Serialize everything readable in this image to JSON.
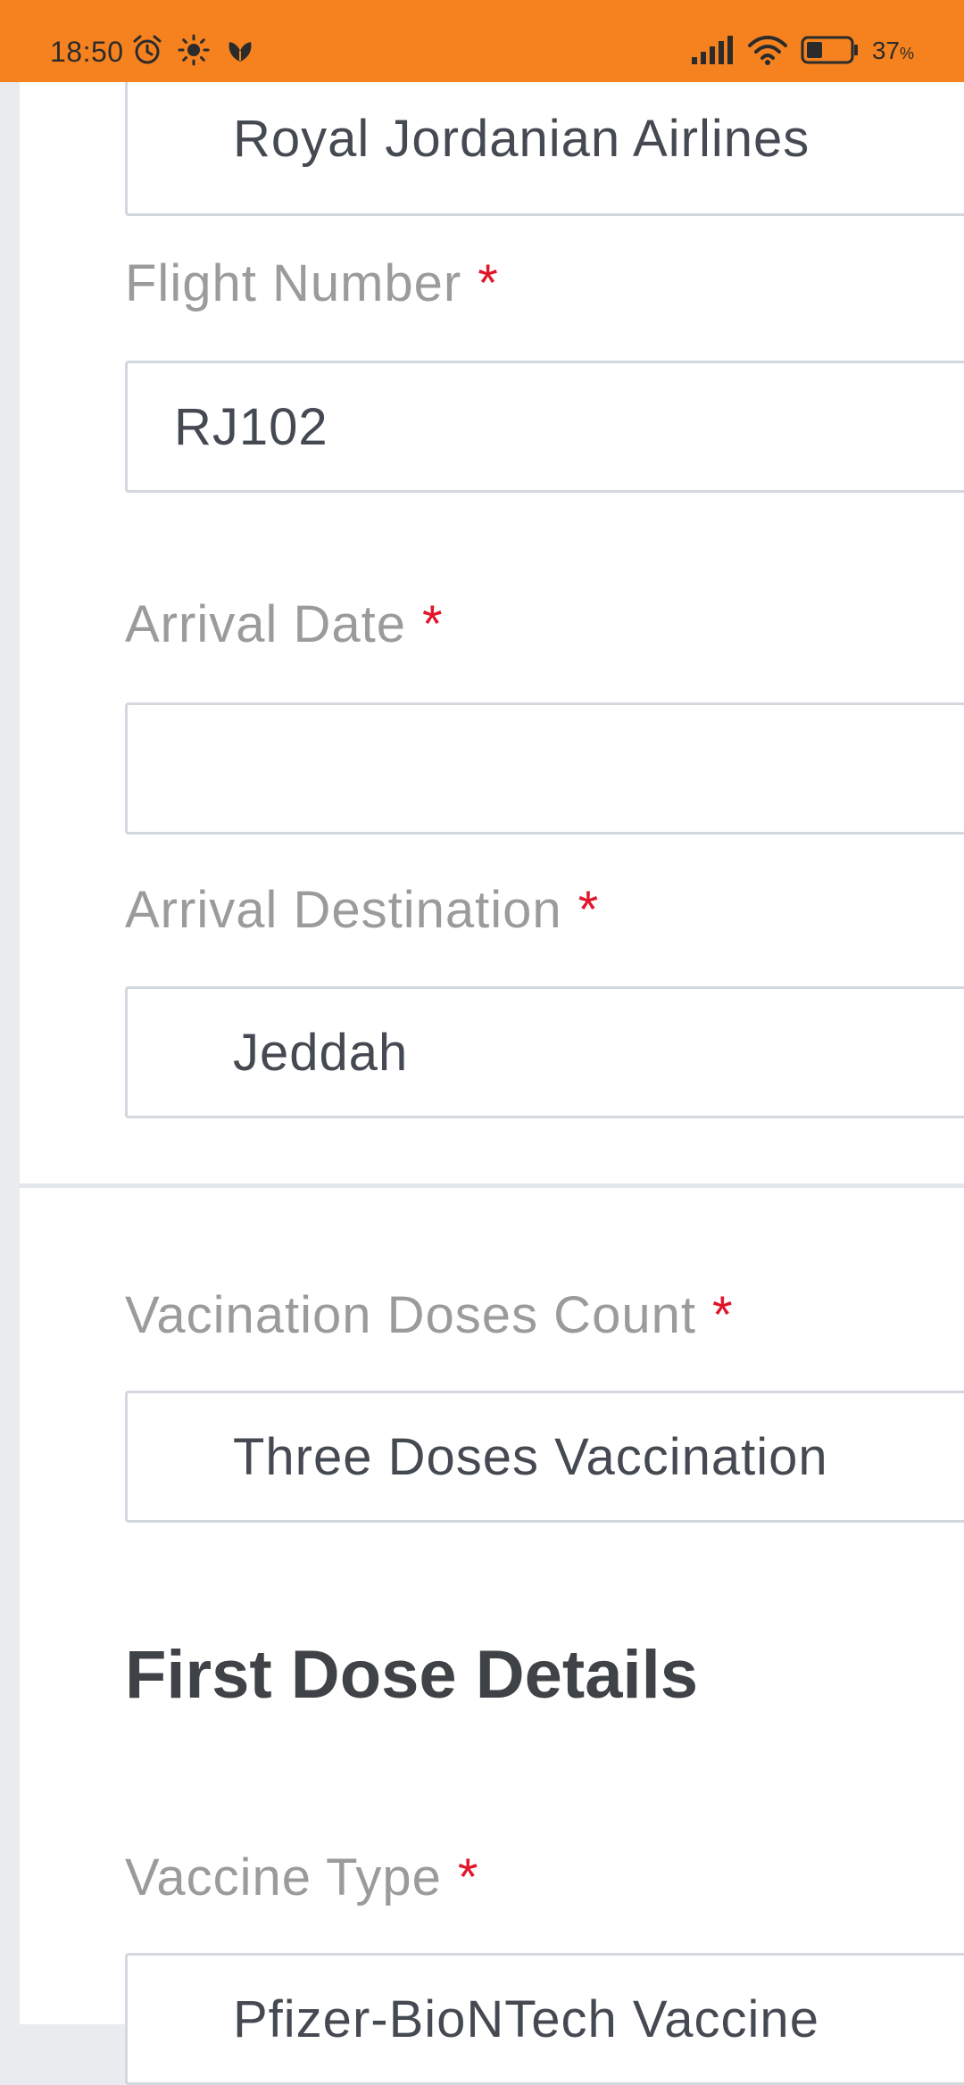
{
  "status_bar": {
    "time": "18:50",
    "battery_percent": "37",
    "battery_unit": "%",
    "battery_level": 0.37,
    "icons_left": [
      "alarm-icon",
      "brightness-icon",
      "app-notification-icon"
    ],
    "icons_right": [
      "signal-icon",
      "wifi-icon",
      "battery-icon"
    ],
    "background_color": "#f5821f"
  },
  "form": {
    "airline": {
      "value": "Royal Jordanian Airlines"
    },
    "flight_number": {
      "label": "Flight Number",
      "required_mark": "*",
      "value": "RJ102"
    },
    "arrival_date": {
      "label": "Arrival Date",
      "required_mark": "*",
      "value": ""
    },
    "arrival_destination": {
      "label": "Arrival Destination",
      "required_mark": "*",
      "value": "Jeddah"
    },
    "doses_count": {
      "label": "Vacination Doses Count",
      "required_mark": "*",
      "value": "Three Doses Vaccination"
    },
    "first_dose_heading": "First Dose Details",
    "vaccine_type": {
      "label": "Vaccine Type",
      "required_mark": "*",
      "value": "Pfizer-BioNTech Vaccine"
    }
  },
  "colors": {
    "required": "#e0162b",
    "label": "#9b9b9b",
    "value": "#454a52",
    "border": "#d3d7de"
  }
}
